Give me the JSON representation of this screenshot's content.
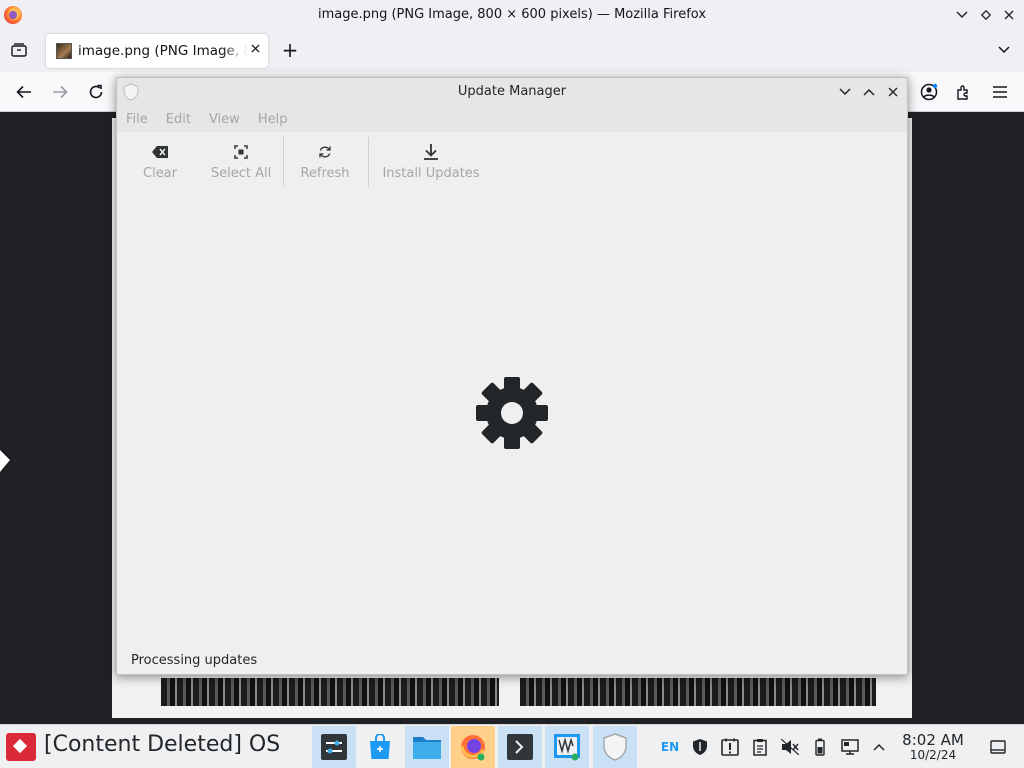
{
  "firefox": {
    "window_title": "image.png (PNG Image, 800 × 600 pixels) — Mozilla Firefox",
    "tab_title": "image.png (PNG Image, 800 × 600 pixels)",
    "new_tab_label": "+"
  },
  "update_manager": {
    "title": "Update Manager",
    "menu": [
      "File",
      "Edit",
      "View",
      "Help"
    ],
    "toolbar": {
      "clear": "Clear",
      "select_all": "Select All",
      "refresh": "Refresh",
      "install_updates": "Install Updates"
    },
    "status": "Processing updates",
    "icons": {
      "clear": "backspace-icon",
      "select_all": "select-all-icon",
      "refresh": "refresh-icon",
      "install": "download-icon",
      "spinner": "gear-icon"
    }
  },
  "taskbar": {
    "os_name": "[Content Deleted] OS",
    "language": "EN",
    "time": "8:02 AM",
    "date": "10/2/24"
  },
  "colors": {
    "accent": "#3daee9",
    "start_red": "#da2a3a",
    "disabled_text": "#a4a6a8"
  }
}
